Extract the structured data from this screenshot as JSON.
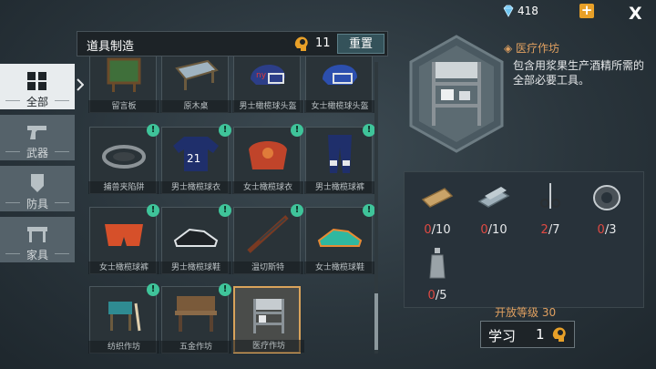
{
  "currency": {
    "gems": "418",
    "gem_icon": "diamond-icon",
    "add_icon": "plus-icon",
    "close": "X"
  },
  "sidebar": {
    "items": [
      {
        "label": "全部",
        "icon": "grid-icon",
        "active": true
      },
      {
        "label": "武器",
        "icon": "pistol-icon",
        "active": false
      },
      {
        "label": "防具",
        "icon": "shield-icon",
        "active": false
      },
      {
        "label": "家具",
        "icon": "table-icon",
        "active": false
      }
    ]
  },
  "panel": {
    "title": "道具制造",
    "skill_points": "11",
    "reset_label": "重置"
  },
  "recipes": [
    {
      "name": "留言板",
      "badge": false
    },
    {
      "name": "原木桌",
      "badge": false
    },
    {
      "name": "男士橄榄球头盔",
      "badge": false
    },
    {
      "name": "女士橄榄球头盔",
      "badge": false
    },
    {
      "name": "捕兽夹陷阱",
      "badge": true
    },
    {
      "name": "男士橄榄球衣",
      "badge": true
    },
    {
      "name": "女士橄榄球衣",
      "badge": true
    },
    {
      "name": "男士橄榄球裤",
      "badge": true
    },
    {
      "name": "女士橄榄球裤",
      "badge": true
    },
    {
      "name": "男士橄榄球鞋",
      "badge": true
    },
    {
      "name": "温切斯特",
      "badge": true
    },
    {
      "name": "女士橄榄球鞋",
      "badge": true
    },
    {
      "name": "纺织作坊",
      "badge": true
    },
    {
      "name": "五金作坊",
      "badge": true
    },
    {
      "name": "医疗作坊",
      "badge": false,
      "selected": true
    }
  ],
  "badge_mark": "!",
  "detail": {
    "name": "医疗作坊",
    "description": "包含用浆果生产酒精所需的全部必要工具。"
  },
  "materials": [
    {
      "icon": "wood-plank-icon",
      "have": "0",
      "need": "/10"
    },
    {
      "icon": "metal-bar-icon",
      "have": "0",
      "need": "/10"
    },
    {
      "icon": "scissors-icon",
      "have": "2",
      "need": "/7"
    },
    {
      "icon": "tape-roll-icon",
      "have": "0",
      "need": "/3"
    },
    {
      "icon": "bottle-icon",
      "have": "0",
      "need": "/5"
    }
  ],
  "unlock_label": "开放等级 30",
  "learn": {
    "label": "学习",
    "cost": "1"
  },
  "colors": {
    "accent": "#e0a060",
    "badge": "#3fc49a",
    "shortage": "#e14a43",
    "reset_bg": "#34525a"
  }
}
